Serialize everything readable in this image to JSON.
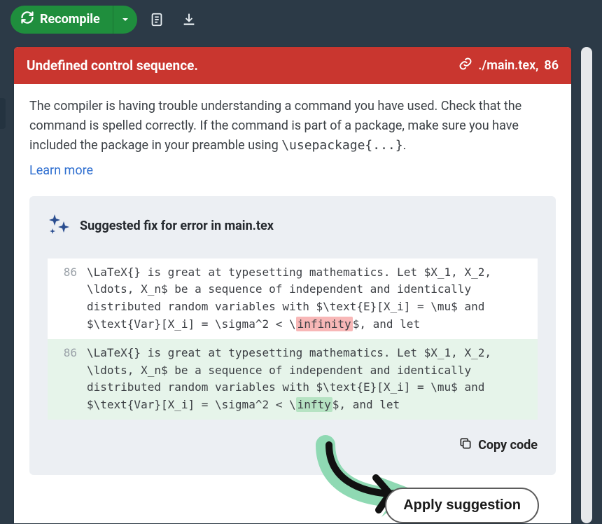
{
  "toolbar": {
    "recompile_label": "Recompile"
  },
  "error": {
    "title": "Undefined control sequence.",
    "file": "./main.tex,",
    "line": "86",
    "message_pre": "The compiler is having trouble understanding a command you have used. Check that the command is spelled correctly. If the command is part of a package, make sure you have included the package in your preamble using ",
    "message_cmd": "\\usepackage{...}",
    "message_post": ".",
    "learn_more": "Learn more"
  },
  "suggestion": {
    "heading": "Suggested fix for error in main.tex",
    "line_no": "86",
    "before_prefix": "\\LaTeX{} is great at typesetting mathematics. Let $X_1, X_2, \\ldots, X_n$ be a sequence of independent and identically distributed random variables with $\\text{E}[X_i] = \\mu$ and $\\text{Var}[X_i] = \\sigma^2 < \\",
    "before_hl": "infinity",
    "before_suffix": "$, and let",
    "after_prefix": "\\LaTeX{} is great at typesetting mathematics. Let $X_1, X_2, \\ldots, X_n$ be a sequence of independent and identically distributed random variables with $\\text{E}[X_i] = \\mu$ and $\\text{Var}[X_i] = \\sigma^2 < \\",
    "after_hl": "infty",
    "after_suffix": "$, and let",
    "copy_label": "Copy code",
    "apply_label": "Apply suggestion"
  }
}
